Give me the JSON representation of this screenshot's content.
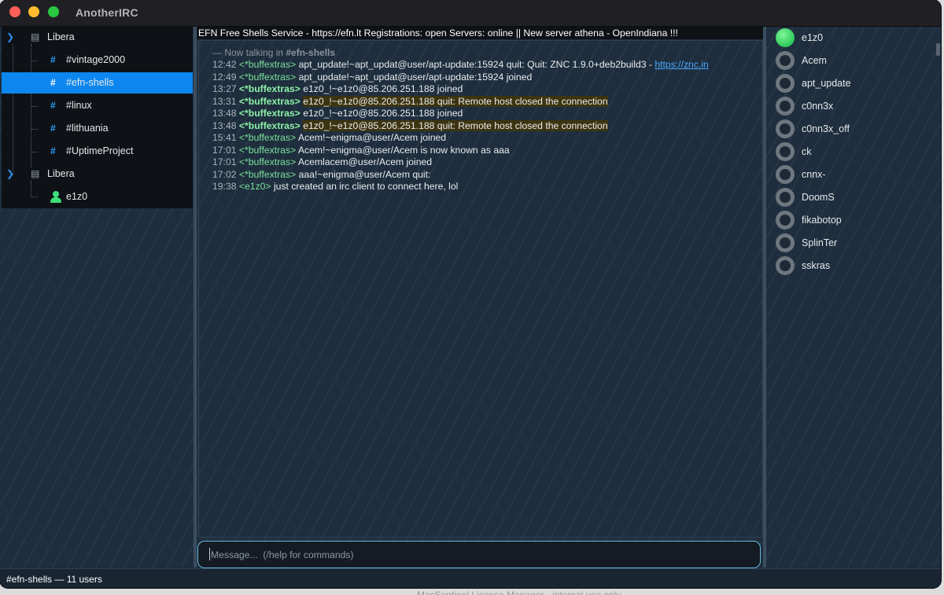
{
  "app": {
    "title": "AnotherIRC"
  },
  "tree": {
    "servers": [
      {
        "label": "Libera",
        "channels": [
          {
            "label": "#vintage2000",
            "selected": false
          },
          {
            "label": "#efn-shells",
            "selected": true
          },
          {
            "label": "#linux",
            "selected": false
          },
          {
            "label": "#lithuania",
            "selected": false
          },
          {
            "label": "#UptimeProject",
            "selected": false
          }
        ]
      },
      {
        "label": "Libera",
        "queries": [
          {
            "label": "e1z0"
          }
        ]
      }
    ]
  },
  "topic": "EFN Free Shells Service - https://efn.lt Registrations: open Servers: online || New server athena - OpenIndiana !!!",
  "chat": {
    "header": {
      "prefix": "— Now talking in ",
      "channel": "#efn-shells"
    },
    "lines": [
      {
        "time": "12:42",
        "nick": "<*buffextras>",
        "msg": "apt_update!~apt_updat@user/apt-update:15924 quit: Quit: ZNC 1.9.0+deb2build3 - ",
        "link": "https://znc.in",
        "bold": false,
        "highlight": false
      },
      {
        "time": "12:49",
        "nick": "<*buffextras>",
        "msg": "apt_update!~apt_updat@user/apt-update:15924 joined",
        "bold": false,
        "highlight": false
      },
      {
        "time": "13:27",
        "nick": "<*buffextras>",
        "msg": "e1z0_!~e1z0@85.206.251.188 joined",
        "bold": true,
        "highlight": false
      },
      {
        "time": "13:31",
        "nick": "<*buffextras>",
        "msg": "e1z0_!~e1z0@85.206.251.188 quit: Remote host closed the connection",
        "bold": true,
        "highlight": true
      },
      {
        "time": "13:48",
        "nick": "<*buffextras>",
        "msg": "e1z0_!~e1z0@85.206.251.188 joined",
        "bold": true,
        "highlight": false
      },
      {
        "time": "13:48",
        "nick": "<*buffextras>",
        "msg": "e1z0_!~e1z0@85.206.251.188 quit: Remote host closed the connection",
        "bold": true,
        "highlight": true
      },
      {
        "time": "15:41",
        "nick": "<*buffextras>",
        "msg": "Acem!~enigma@user/Acem joined",
        "bold": false,
        "highlight": false
      },
      {
        "time": "17:01",
        "nick": "<*buffextras>",
        "msg": "Acem!~enigma@user/Acem is now known as aaa",
        "bold": false,
        "highlight": false
      },
      {
        "time": "17:01",
        "nick": "<*buffextras>",
        "msg": "Acemlacem@user/Acem joined",
        "bold": false,
        "highlight": false
      },
      {
        "time": "17:02",
        "nick": "<*buffextras>",
        "msg": "aaa!~enigma@user/Acem quit:",
        "bold": false,
        "highlight": false
      },
      {
        "time": "19:38",
        "nick": "<e1z0>",
        "msg": "just created an irc client to connect here, lol",
        "bold": false,
        "highlight": false
      }
    ]
  },
  "input": {
    "placeholder": "Message...  (/help for commands)",
    "value": ""
  },
  "users": [
    {
      "name": "e1z0",
      "online": true
    },
    {
      "name": "Acem",
      "online": false
    },
    {
      "name": "apt_update",
      "online": false
    },
    {
      "name": "c0nn3x",
      "online": false
    },
    {
      "name": "c0nn3x_off",
      "online": false
    },
    {
      "name": "ck",
      "online": false
    },
    {
      "name": "cnnx-",
      "online": false
    },
    {
      "name": "DoomS",
      "online": false
    },
    {
      "name": "fikabotop",
      "online": false
    },
    {
      "name": "SplinTer",
      "online": false
    },
    {
      "name": "sskras",
      "online": false
    }
  ],
  "status": {
    "text": "#efn-shells — 11 users"
  },
  "background_window": {
    "text": "MacSentinel License Manager - internal use only"
  },
  "colors": {
    "accent": "#0d87ef",
    "nick": "#7be09a",
    "online": "#2ec95a",
    "highlight": "#3d3410"
  }
}
